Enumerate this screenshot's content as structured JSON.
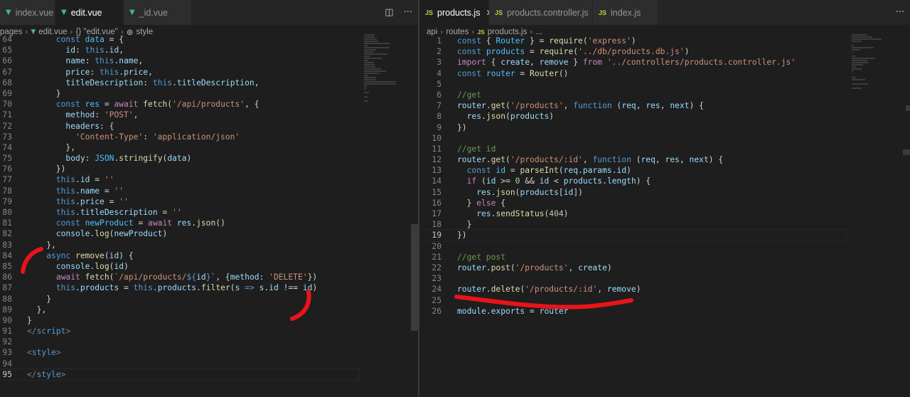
{
  "left": {
    "tabs": [
      {
        "label": "index.vue",
        "icon": "vue-icon",
        "active": false
      },
      {
        "label": "edit.vue",
        "icon": "vue-icon",
        "active": true
      },
      {
        "label": "_id.vue",
        "icon": "vue-icon",
        "active": false
      }
    ],
    "breadcrumb": [
      "pages",
      "edit.vue",
      "{} \"edit.vue\"",
      "style"
    ],
    "line_start": 64,
    "current_line": 95,
    "lines": [
      [
        [
          "pl",
          "      "
        ],
        [
          "kw",
          "const "
        ],
        [
          "cst",
          "data"
        ],
        [
          "pl",
          " = {"
        ]
      ],
      [
        [
          "pl",
          "        "
        ],
        [
          "var",
          "id"
        ],
        [
          "pl",
          ": "
        ],
        [
          "kw",
          "this"
        ],
        [
          "pl",
          "."
        ],
        [
          "var",
          "id"
        ],
        [
          "pl",
          ","
        ]
      ],
      [
        [
          "pl",
          "        "
        ],
        [
          "var",
          "name"
        ],
        [
          "pl",
          ": "
        ],
        [
          "kw",
          "this"
        ],
        [
          "pl",
          "."
        ],
        [
          "var",
          "name"
        ],
        [
          "pl",
          ","
        ]
      ],
      [
        [
          "pl",
          "        "
        ],
        [
          "var",
          "price"
        ],
        [
          "pl",
          ": "
        ],
        [
          "kw",
          "this"
        ],
        [
          "pl",
          "."
        ],
        [
          "var",
          "price"
        ],
        [
          "pl",
          ","
        ]
      ],
      [
        [
          "pl",
          "        "
        ],
        [
          "var",
          "titleDescription"
        ],
        [
          "pl",
          ": "
        ],
        [
          "kw",
          "this"
        ],
        [
          "pl",
          "."
        ],
        [
          "var",
          "titleDescription"
        ],
        [
          "pl",
          ","
        ]
      ],
      [
        [
          "pl",
          "      }"
        ]
      ],
      [
        [
          "pl",
          "      "
        ],
        [
          "kw",
          "const "
        ],
        [
          "cst",
          "res"
        ],
        [
          "pl",
          " = "
        ],
        [
          "ctl",
          "await "
        ],
        [
          "fn",
          "fetch"
        ],
        [
          "pl",
          "("
        ],
        [
          "str",
          "'/api/products'"
        ],
        [
          "pl",
          ", {"
        ]
      ],
      [
        [
          "pl",
          "        "
        ],
        [
          "var",
          "method"
        ],
        [
          "pl",
          ": "
        ],
        [
          "str",
          "'POST'"
        ],
        [
          "pl",
          ","
        ]
      ],
      [
        [
          "pl",
          "        "
        ],
        [
          "var",
          "headers"
        ],
        [
          "pl",
          ": {"
        ]
      ],
      [
        [
          "pl",
          "          "
        ],
        [
          "str",
          "'Content-Type'"
        ],
        [
          "pl",
          ": "
        ],
        [
          "str",
          "'application/json'"
        ]
      ],
      [
        [
          "pl",
          "        },"
        ]
      ],
      [
        [
          "pl",
          "        "
        ],
        [
          "var",
          "body"
        ],
        [
          "pl",
          ": "
        ],
        [
          "cst",
          "JSON"
        ],
        [
          "pl",
          "."
        ],
        [
          "fn",
          "stringify"
        ],
        [
          "pl",
          "("
        ],
        [
          "var",
          "data"
        ],
        [
          "pl",
          ")"
        ]
      ],
      [
        [
          "pl",
          "      })"
        ]
      ],
      [
        [
          "pl",
          "      "
        ],
        [
          "kw",
          "this"
        ],
        [
          "pl",
          "."
        ],
        [
          "var",
          "id"
        ],
        [
          "pl",
          " = "
        ],
        [
          "str",
          "''"
        ]
      ],
      [
        [
          "pl",
          "      "
        ],
        [
          "kw",
          "this"
        ],
        [
          "pl",
          "."
        ],
        [
          "var",
          "name"
        ],
        [
          "pl",
          " = "
        ],
        [
          "str",
          "''"
        ]
      ],
      [
        [
          "pl",
          "      "
        ],
        [
          "kw",
          "this"
        ],
        [
          "pl",
          "."
        ],
        [
          "var",
          "price"
        ],
        [
          "pl",
          " = "
        ],
        [
          "str",
          "''"
        ]
      ],
      [
        [
          "pl",
          "      "
        ],
        [
          "kw",
          "this"
        ],
        [
          "pl",
          "."
        ],
        [
          "var",
          "titleDescription"
        ],
        [
          "pl",
          " = "
        ],
        [
          "str",
          "''"
        ]
      ],
      [
        [
          "pl",
          "      "
        ],
        [
          "kw",
          "const "
        ],
        [
          "cst",
          "newProduct"
        ],
        [
          "pl",
          " = "
        ],
        [
          "ctl",
          "await "
        ],
        [
          "var",
          "res"
        ],
        [
          "pl",
          "."
        ],
        [
          "fn",
          "json"
        ],
        [
          "pl",
          "()"
        ]
      ],
      [
        [
          "pl",
          "      "
        ],
        [
          "var",
          "console"
        ],
        [
          "pl",
          "."
        ],
        [
          "fn",
          "log"
        ],
        [
          "pl",
          "("
        ],
        [
          "var",
          "newProduct"
        ],
        [
          "pl",
          ")"
        ]
      ],
      [
        [
          "pl",
          "    },"
        ]
      ],
      [
        [
          "pl",
          "    "
        ],
        [
          "kw",
          "async "
        ],
        [
          "fn",
          "remove"
        ],
        [
          "pl",
          "("
        ],
        [
          "var",
          "id"
        ],
        [
          "pl",
          ") {"
        ]
      ],
      [
        [
          "pl",
          "      "
        ],
        [
          "var",
          "console"
        ],
        [
          "pl",
          "."
        ],
        [
          "fn",
          "log"
        ],
        [
          "pl",
          "("
        ],
        [
          "var",
          "id"
        ],
        [
          "pl",
          ")"
        ]
      ],
      [
        [
          "pl",
          "      "
        ],
        [
          "ctl",
          "await "
        ],
        [
          "fn",
          "fetch"
        ],
        [
          "pl",
          "("
        ],
        [
          "str",
          "`/api/products/"
        ],
        [
          "kw",
          "${"
        ],
        [
          "var",
          "id"
        ],
        [
          "kw",
          "}"
        ],
        [
          "str",
          "`"
        ],
        [
          "pl",
          ", {"
        ],
        [
          "var",
          "method"
        ],
        [
          "pl",
          ": "
        ],
        [
          "str",
          "'DELETE'"
        ],
        [
          "pl",
          "})"
        ]
      ],
      [
        [
          "pl",
          "      "
        ],
        [
          "kw",
          "this"
        ],
        [
          "pl",
          "."
        ],
        [
          "var",
          "products"
        ],
        [
          "pl",
          " = "
        ],
        [
          "kw",
          "this"
        ],
        [
          "pl",
          "."
        ],
        [
          "var",
          "products"
        ],
        [
          "pl",
          "."
        ],
        [
          "fn",
          "filter"
        ],
        [
          "pl",
          "("
        ],
        [
          "var",
          "s"
        ],
        [
          "pl",
          " "
        ],
        [
          "kw",
          "=>"
        ],
        [
          "pl",
          " "
        ],
        [
          "var",
          "s"
        ],
        [
          "pl",
          "."
        ],
        [
          "var",
          "id"
        ],
        [
          "pl",
          " !== "
        ],
        [
          "var",
          "id"
        ],
        [
          "pl",
          ")"
        ]
      ],
      [
        [
          "pl",
          "    }"
        ]
      ],
      [
        [
          "pl",
          "  },"
        ]
      ],
      [
        [
          "pl",
          "}"
        ]
      ],
      [
        [
          "tag",
          "</"
        ],
        [
          "tname",
          "script"
        ],
        [
          "tag",
          ">"
        ]
      ],
      [
        [
          "pl",
          ""
        ]
      ],
      [
        [
          "tag",
          "<"
        ],
        [
          "tname",
          "style"
        ],
        [
          "tag",
          ">"
        ]
      ],
      [
        [
          "pl",
          ""
        ]
      ],
      [
        [
          "tag",
          "</"
        ],
        [
          "tname",
          "style"
        ],
        [
          "tag",
          ">"
        ]
      ]
    ]
  },
  "right": {
    "tabs": [
      {
        "label": "products.js",
        "icon": "js-icon",
        "active": true,
        "closable": true
      },
      {
        "label": "products.controller.js",
        "icon": "js-icon",
        "active": false
      },
      {
        "label": "index.js",
        "icon": "js-icon",
        "active": false
      }
    ],
    "breadcrumb": [
      "api",
      "routes",
      "products.js",
      "..."
    ],
    "line_start": 1,
    "current_line": 19,
    "lines": [
      [
        [
          "kw",
          "const "
        ],
        [
          "pl",
          "{ "
        ],
        [
          "cst",
          "Router"
        ],
        [
          "pl",
          " } = "
        ],
        [
          "fn",
          "require"
        ],
        [
          "pl",
          "("
        ],
        [
          "str",
          "'express'"
        ],
        [
          "pl",
          ")"
        ]
      ],
      [
        [
          "kw",
          "const "
        ],
        [
          "cst",
          "products"
        ],
        [
          "pl",
          " = "
        ],
        [
          "fn",
          "require"
        ],
        [
          "pl",
          "("
        ],
        [
          "str",
          "'../db/products.db.js'"
        ],
        [
          "pl",
          ")"
        ]
      ],
      [
        [
          "ctl",
          "import "
        ],
        [
          "pl",
          "{ "
        ],
        [
          "var",
          "create"
        ],
        [
          "pl",
          ", "
        ],
        [
          "var",
          "remove"
        ],
        [
          "pl",
          " } "
        ],
        [
          "ctl",
          "from "
        ],
        [
          "str",
          "'../controllers/products.controller.js'"
        ]
      ],
      [
        [
          "kw",
          "const "
        ],
        [
          "cst",
          "router"
        ],
        [
          "pl",
          " = "
        ],
        [
          "fn",
          "Router"
        ],
        [
          "pl",
          "()"
        ]
      ],
      [
        [
          "pl",
          ""
        ]
      ],
      [
        [
          "cmt",
          "//get"
        ]
      ],
      [
        [
          "var",
          "router"
        ],
        [
          "pl",
          "."
        ],
        [
          "fn",
          "get"
        ],
        [
          "pl",
          "("
        ],
        [
          "str",
          "'/products'"
        ],
        [
          "pl",
          ", "
        ],
        [
          "kw",
          "function "
        ],
        [
          "pl",
          "("
        ],
        [
          "var",
          "req"
        ],
        [
          "pl",
          ", "
        ],
        [
          "var",
          "res"
        ],
        [
          "pl",
          ", "
        ],
        [
          "var",
          "next"
        ],
        [
          "pl",
          ") {"
        ]
      ],
      [
        [
          "pl",
          "  "
        ],
        [
          "var",
          "res"
        ],
        [
          "pl",
          "."
        ],
        [
          "fn",
          "json"
        ],
        [
          "pl",
          "("
        ],
        [
          "var",
          "products"
        ],
        [
          "pl",
          ")"
        ]
      ],
      [
        [
          "pl",
          "})"
        ]
      ],
      [
        [
          "pl",
          ""
        ]
      ],
      [
        [
          "cmt",
          "//get id"
        ]
      ],
      [
        [
          "var",
          "router"
        ],
        [
          "pl",
          "."
        ],
        [
          "fn",
          "get"
        ],
        [
          "pl",
          "("
        ],
        [
          "str",
          "'/products/:id'"
        ],
        [
          "pl",
          ", "
        ],
        [
          "kw",
          "function "
        ],
        [
          "pl",
          "("
        ],
        [
          "var",
          "req"
        ],
        [
          "pl",
          ", "
        ],
        [
          "var",
          "res"
        ],
        [
          "pl",
          ", "
        ],
        [
          "var",
          "next"
        ],
        [
          "pl",
          ") {"
        ]
      ],
      [
        [
          "pl",
          "  "
        ],
        [
          "kw",
          "const "
        ],
        [
          "cst",
          "id"
        ],
        [
          "pl",
          " = "
        ],
        [
          "fn",
          "parseInt"
        ],
        [
          "pl",
          "("
        ],
        [
          "var",
          "req"
        ],
        [
          "pl",
          "."
        ],
        [
          "var",
          "params"
        ],
        [
          "pl",
          "."
        ],
        [
          "var",
          "id"
        ],
        [
          "pl",
          ")"
        ]
      ],
      [
        [
          "pl",
          "  "
        ],
        [
          "ctl",
          "if "
        ],
        [
          "pl",
          "("
        ],
        [
          "var",
          "id"
        ],
        [
          "pl",
          " >= "
        ],
        [
          "num",
          "0"
        ],
        [
          "pl",
          " && "
        ],
        [
          "var",
          "id"
        ],
        [
          "pl",
          " < "
        ],
        [
          "var",
          "products"
        ],
        [
          "pl",
          "."
        ],
        [
          "var",
          "length"
        ],
        [
          "pl",
          ") {"
        ]
      ],
      [
        [
          "pl",
          "    "
        ],
        [
          "var",
          "res"
        ],
        [
          "pl",
          "."
        ],
        [
          "fn",
          "json"
        ],
        [
          "pl",
          "("
        ],
        [
          "var",
          "products"
        ],
        [
          "pl",
          "["
        ],
        [
          "var",
          "id"
        ],
        [
          "pl",
          "])"
        ]
      ],
      [
        [
          "pl",
          "  } "
        ],
        [
          "ctl",
          "else "
        ],
        [
          "pl",
          "{"
        ]
      ],
      [
        [
          "pl",
          "    "
        ],
        [
          "var",
          "res"
        ],
        [
          "pl",
          "."
        ],
        [
          "fn",
          "sendStatus"
        ],
        [
          "pl",
          "("
        ],
        [
          "num",
          "404"
        ],
        [
          "pl",
          ")"
        ]
      ],
      [
        [
          "pl",
          "  }"
        ]
      ],
      [
        [
          "pl",
          "})"
        ]
      ],
      [
        [
          "pl",
          ""
        ]
      ],
      [
        [
          "cmt",
          "//get post"
        ]
      ],
      [
        [
          "var",
          "router"
        ],
        [
          "pl",
          "."
        ],
        [
          "fn",
          "post"
        ],
        [
          "pl",
          "("
        ],
        [
          "str",
          "'/products'"
        ],
        [
          "pl",
          ", "
        ],
        [
          "var",
          "create"
        ],
        [
          "pl",
          ")"
        ]
      ],
      [
        [
          "pl",
          ""
        ]
      ],
      [
        [
          "var",
          "router"
        ],
        [
          "pl",
          "."
        ],
        [
          "fn",
          "delete"
        ],
        [
          "pl",
          "("
        ],
        [
          "str",
          "'/products/:id'"
        ],
        [
          "pl",
          ", "
        ],
        [
          "var",
          "remove"
        ],
        [
          "pl",
          ")"
        ]
      ],
      [
        [
          "pl",
          ""
        ]
      ],
      [
        [
          "var",
          "module"
        ],
        [
          "pl",
          "."
        ],
        [
          "var",
          "exports"
        ],
        [
          "pl",
          " = "
        ],
        [
          "var",
          "router"
        ]
      ]
    ]
  },
  "annotation_color": "#e8141b"
}
